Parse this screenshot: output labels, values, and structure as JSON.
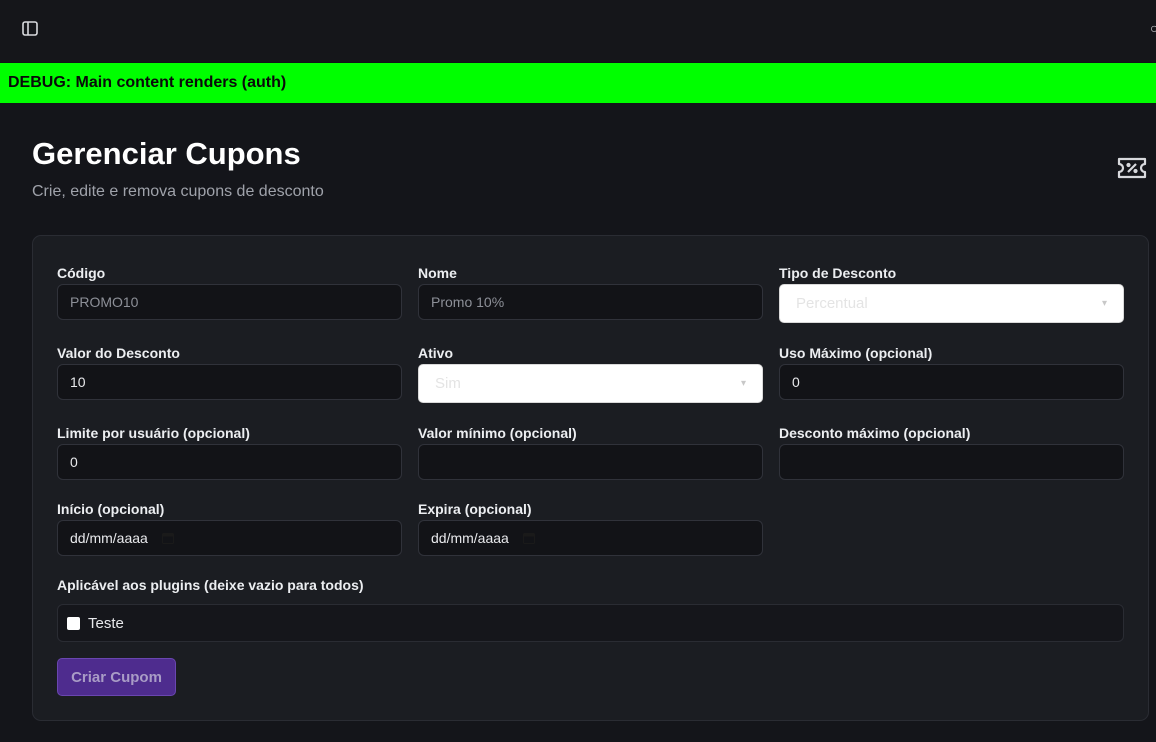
{
  "debug": {
    "text": "DEBUG: Main content renders (auth)"
  },
  "page": {
    "title": "Gerenciar Cupons",
    "subtitle": "Crie, edite e remova cupons de desconto"
  },
  "form": {
    "codigo": {
      "label": "Código",
      "placeholder": "PROMO10",
      "value": ""
    },
    "nome": {
      "label": "Nome",
      "placeholder": "Promo 10%",
      "value": ""
    },
    "tipo_desconto": {
      "label": "Tipo de Desconto",
      "value": "Percentual"
    },
    "valor_desconto": {
      "label": "Valor do Desconto",
      "value": "10"
    },
    "ativo": {
      "label": "Ativo",
      "value": "Sim"
    },
    "uso_maximo": {
      "label": "Uso Máximo (opcional)",
      "value": "0"
    },
    "limite_usuario": {
      "label": "Limite por usuário (opcional)",
      "value": "0"
    },
    "valor_minimo": {
      "label": "Valor mínimo (opcional)",
      "value": ""
    },
    "desconto_maximo": {
      "label": "Desconto máximo (opcional)",
      "value": ""
    },
    "inicio": {
      "label": "Início (opcional)",
      "placeholder": "dd/mm/aaaa"
    },
    "expira": {
      "label": "Expira (opcional)",
      "placeholder": "dd/mm/aaaa"
    },
    "plugins": {
      "label": "Aplicável aos plugins (deixe vazio para todos)",
      "options": [
        {
          "label": "Teste",
          "checked": false
        }
      ]
    },
    "submit_label": "Criar Cupom"
  },
  "colors": {
    "debug_bar": "#00ff00",
    "button": "#4e2c8e",
    "background": "#121317"
  },
  "icons": {
    "sidebar_toggle": "sidebar-toggle-icon",
    "ticket": "ticket-icon",
    "calendar": "calendar-icon"
  }
}
